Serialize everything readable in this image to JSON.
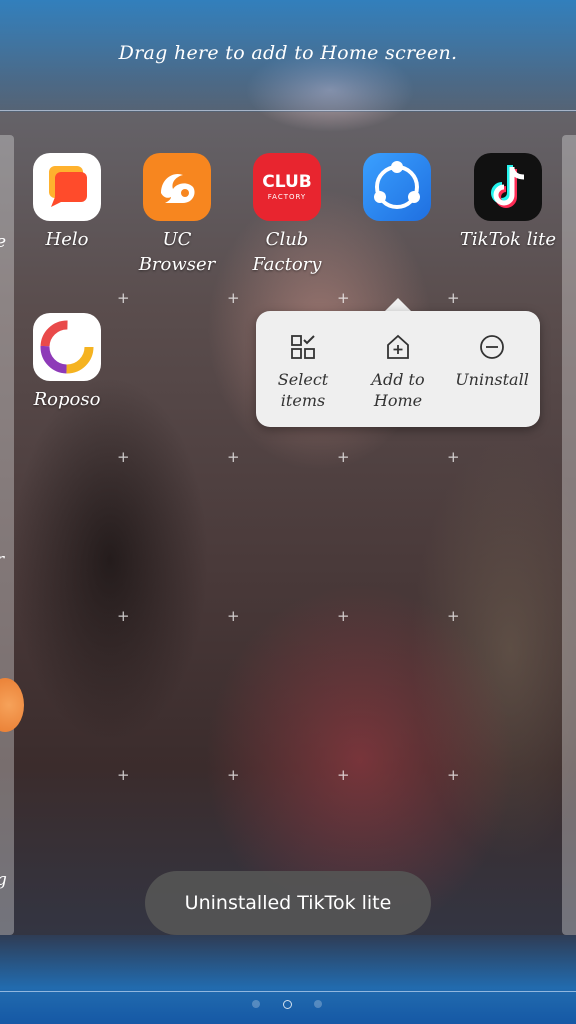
{
  "drag_hint": "Drag here to add to Home screen.",
  "edge_labels": {
    "left_top": "e",
    "left_mid": "r",
    "left_bottom": "g"
  },
  "apps": [
    {
      "name": "Helo",
      "icon": "helo-icon",
      "color": "#ff6a1f"
    },
    {
      "name": "UC Browser",
      "icon": "uc-browser-icon",
      "color": "#f7861f"
    },
    {
      "name_line1": "Club",
      "name_line2": "Factory",
      "icon": "club-factory-icon",
      "color": "#e8252f",
      "icon_text1": "CLUB",
      "icon_text2": "FACTORY"
    },
    {
      "name": "",
      "icon": "shareit-icon",
      "color": "#2b8cf2"
    },
    {
      "name": "TikTok lite",
      "icon": "tiktok-lite-icon",
      "color": "#111111"
    },
    {
      "name": "Roposo",
      "icon": "roposo-icon",
      "color": "#ffffff"
    }
  ],
  "context_menu": {
    "select_items": {
      "line1": "Select",
      "line2": "items"
    },
    "add_to_home": {
      "line1": "Add to",
      "line2": "Home"
    },
    "uninstall": {
      "line1": "Uninstall"
    }
  },
  "toast": "Uninstalled TikTok lite",
  "colors": {
    "top_band": "#2d84c8",
    "popup_bg": "#efefef",
    "toast_bg": "#555555"
  }
}
